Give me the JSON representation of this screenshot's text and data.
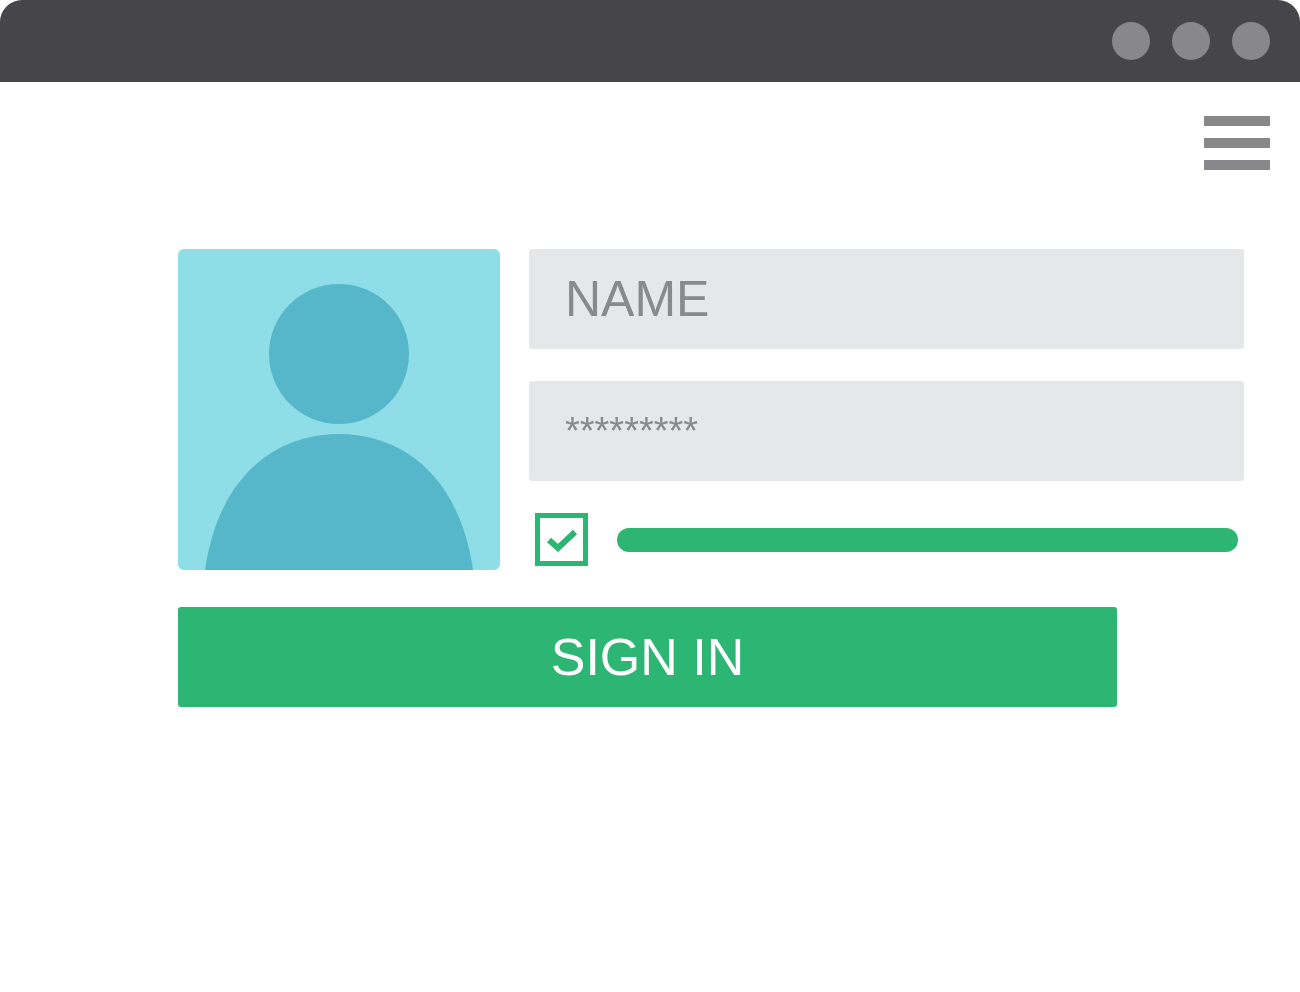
{
  "login_form": {
    "name_field": {
      "placeholder": "NAME"
    },
    "password_field": {
      "value": "*********"
    },
    "remember_checkbox": {
      "checked": true
    },
    "sign_in_button": {
      "label": "SIGN IN"
    }
  }
}
